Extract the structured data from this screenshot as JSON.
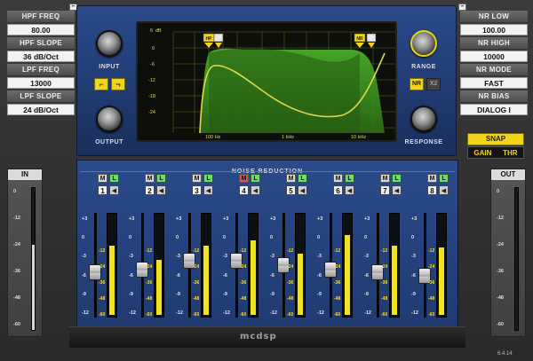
{
  "left_params": [
    {
      "label": "HPF FREQ",
      "value": "80.00"
    },
    {
      "label": "HPF SLOPE",
      "value": "36 dB/Oct"
    },
    {
      "label": "LPF FREQ",
      "value": "13000"
    },
    {
      "label": "LPF SLOPE",
      "value": "24 dB/Oct"
    }
  ],
  "right_params": [
    {
      "label": "NR LOW",
      "value": "100.00"
    },
    {
      "label": "NR HIGH",
      "value": "10000"
    },
    {
      "label": "NR MODE",
      "value": "FAST"
    },
    {
      "label": "NR BIAS",
      "value": "DIALOG I"
    }
  ],
  "collapse_glyph": "–",
  "knobs": {
    "input": "INPUT",
    "output": "OUTPUT",
    "range": "RANGE",
    "response": "RESPONSE"
  },
  "filter_buttons": {
    "hpf": "⌐",
    "lpf": "¬"
  },
  "nr_buttons": {
    "nr": "NR",
    "x2": "X2"
  },
  "display": {
    "y_ticks": [
      "6",
      "0",
      "-6",
      "-12",
      "-18",
      "-24"
    ],
    "y_unit": "dB",
    "x_ticks": [
      "100 Hz",
      "1 kHz",
      "10 kHz"
    ],
    "hpf_marker": "HP",
    "nr_marker": "NR"
  },
  "section_title": "NOISE REDUCTION",
  "channel_buttons": {
    "m": "M",
    "l": "L",
    "speaker": "◀"
  },
  "channels": [
    {
      "num": "1",
      "fader": 0.42,
      "meter": 0.7,
      "m_active": false
    },
    {
      "num": "2",
      "fader": 0.45,
      "meter": 0.55,
      "m_active": false
    },
    {
      "num": "3",
      "fader": 0.55,
      "meter": 0.7,
      "m_active": false
    },
    {
      "num": "4",
      "fader": 0.55,
      "meter": 0.75,
      "m_active": true
    },
    {
      "num": "5",
      "fader": 0.5,
      "meter": 0.62,
      "m_active": false
    },
    {
      "num": "6",
      "fader": 0.45,
      "meter": 0.8,
      "m_active": false
    },
    {
      "num": "7",
      "fader": 0.42,
      "meter": 0.7,
      "m_active": false
    },
    {
      "num": "8",
      "fader": 0.38,
      "meter": 0.68,
      "m_active": false
    }
  ],
  "fader_scale": [
    "+3",
    "0",
    "-3",
    "-6",
    "-9",
    "-12"
  ],
  "meter_scale": [
    "-12",
    "-24",
    "-36",
    "-48",
    "-60"
  ],
  "io_meters": {
    "in_label": "IN",
    "out_label": "OUT",
    "in_level": 0.6,
    "out_level": 0.0,
    "scale": [
      "0",
      "-12",
      "-24",
      "-36",
      "-48",
      "-60"
    ]
  },
  "snap": {
    "label": "SNAP",
    "gain": "GAIN",
    "thr": "THR"
  },
  "version": "6.4.14",
  "logo": "mcdsp",
  "colors": {
    "accent_yellow": "#f2d41a",
    "panel_blue": "#1f3a70",
    "curve_green": "#3fa81e",
    "curve_yellow": "#e0d84a"
  }
}
